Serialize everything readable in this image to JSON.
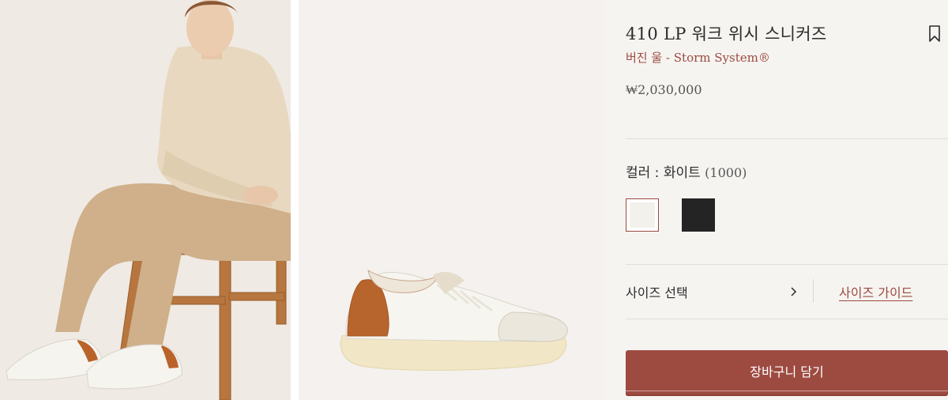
{
  "gallery": {
    "model_photo_alt": "model-sitting-on-wooden-stool",
    "shoe_photo_alt": "white-sneaker-side-view"
  },
  "product": {
    "title": "410 LP 워크 위시 스니커즈",
    "subtitle": "버진 울 - Storm System®",
    "price": "₩2,030,000"
  },
  "color": {
    "label": "컬러 : 화이트",
    "code": "(1000)",
    "swatches": [
      {
        "name": "white",
        "hex": "#f2f1ec",
        "selected": true
      },
      {
        "name": "black",
        "hex": "#242424",
        "selected": false
      }
    ]
  },
  "size": {
    "select_label": "사이즈 선택",
    "guide_label": "사이즈 가이드"
  },
  "cart": {
    "button_label": "장바구니 담기"
  },
  "colors": {
    "accent": "#9d4b41",
    "text": "#2b2b2b",
    "background": "#f6f4f1"
  },
  "icons": {
    "bookmark": "bookmark-icon",
    "chevron": "chevron-right-icon"
  }
}
